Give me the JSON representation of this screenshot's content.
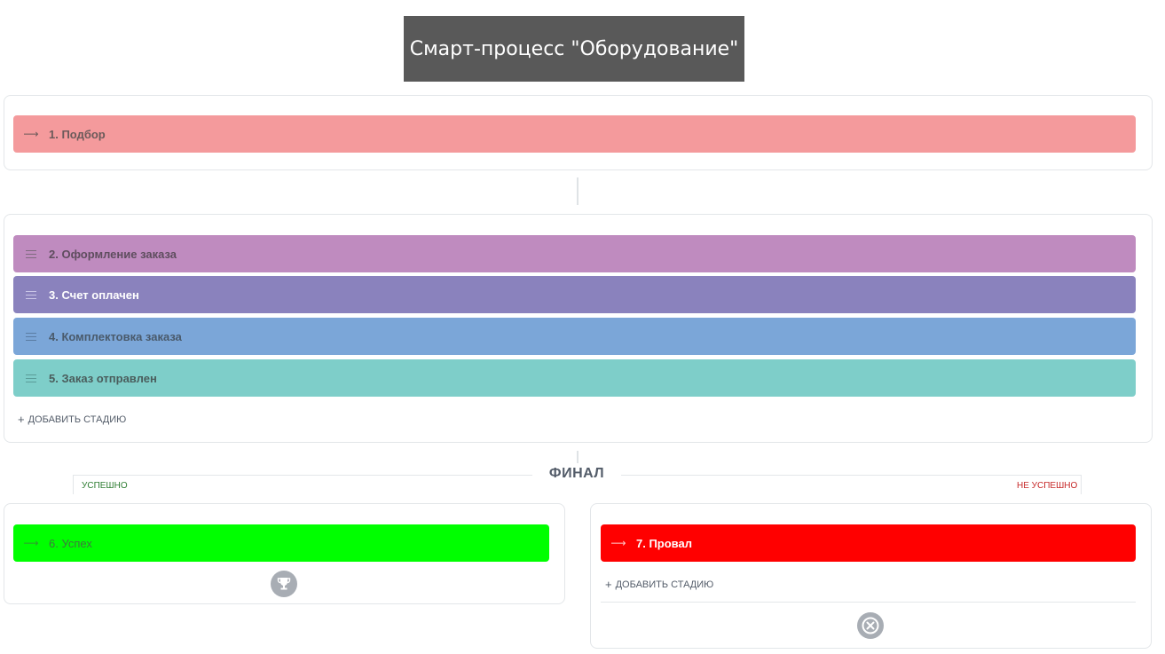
{
  "title": "Смарт-процесс \"Оборудование\"",
  "first_stage": {
    "label": "1. Подбор",
    "color": "#f49a9c",
    "icon": "arrow-right-icon"
  },
  "process_stages": [
    {
      "label": "2. Оформление заказа",
      "color": "#bf8bbf",
      "icon": "drag-handle-icon"
    },
    {
      "label": "3. Счет оплачен",
      "color": "#8a82bd",
      "icon": "drag-handle-icon"
    },
    {
      "label": "4. Комплектовка заказа",
      "color": "#7ba6d8",
      "icon": "drag-handle-icon"
    },
    {
      "label": "5. Заказ отправлен",
      "color": "#7ecec9",
      "icon": "drag-handle-icon"
    }
  ],
  "add_stage_label": "ДОБАВИТЬ СТАДИЮ",
  "final": {
    "title": "ФИНАЛ",
    "success_label": "УСПЕШНО",
    "fail_label": "НЕ УСПЕШНО",
    "success_stage": {
      "label": "6. Успех",
      "color": "#00ff00",
      "icon": "arrow-right-icon"
    },
    "fail_stage": {
      "label": "7. Провал",
      "color": "#ff0000",
      "icon": "arrow-right-icon"
    },
    "fail_add_stage_label": "ДОБАВИТЬ СТАДИЮ",
    "success_icon": "trophy-icon",
    "fail_icon": "close-circle-icon"
  },
  "colors": {
    "success_text": "#2e7d32",
    "fail_text": "#c62828",
    "icon_gray": "#a8adb4"
  }
}
